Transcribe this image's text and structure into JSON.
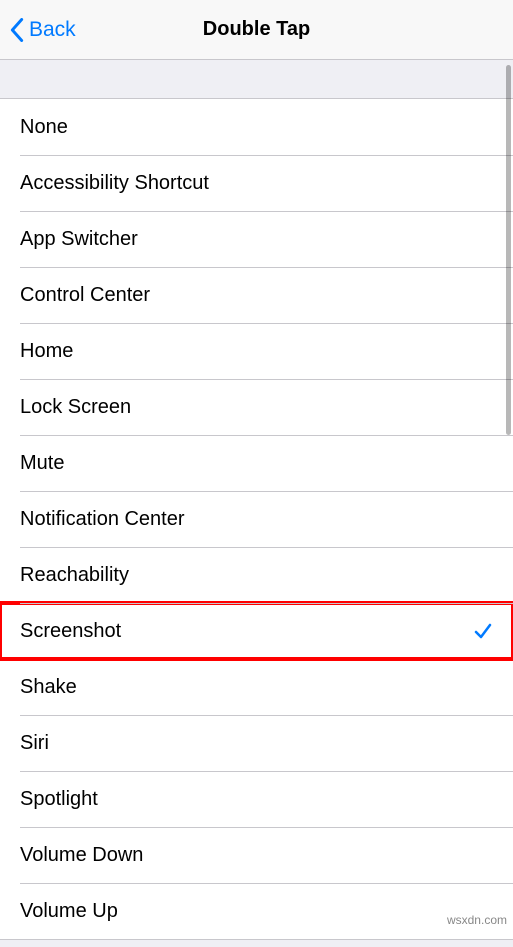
{
  "header": {
    "back_label": "Back",
    "title": "Double Tap"
  },
  "options": [
    {
      "label": "None",
      "selected": false,
      "highlight": false
    },
    {
      "label": "Accessibility Shortcut",
      "selected": false,
      "highlight": false
    },
    {
      "label": "App Switcher",
      "selected": false,
      "highlight": false
    },
    {
      "label": "Control Center",
      "selected": false,
      "highlight": false
    },
    {
      "label": "Home",
      "selected": false,
      "highlight": false
    },
    {
      "label": "Lock Screen",
      "selected": false,
      "highlight": false
    },
    {
      "label": "Mute",
      "selected": false,
      "highlight": false
    },
    {
      "label": "Notification Center",
      "selected": false,
      "highlight": false
    },
    {
      "label": "Reachability",
      "selected": false,
      "highlight": false
    },
    {
      "label": "Screenshot",
      "selected": true,
      "highlight": true
    },
    {
      "label": "Shake",
      "selected": false,
      "highlight": false
    },
    {
      "label": "Siri",
      "selected": false,
      "highlight": false
    },
    {
      "label": "Spotlight",
      "selected": false,
      "highlight": false
    },
    {
      "label": "Volume Down",
      "selected": false,
      "highlight": false
    },
    {
      "label": "Volume Up",
      "selected": false,
      "highlight": false
    }
  ],
  "watermark": "wsxdn.com",
  "colors": {
    "accent": "#007aff",
    "highlight_border": "#ff0000"
  }
}
